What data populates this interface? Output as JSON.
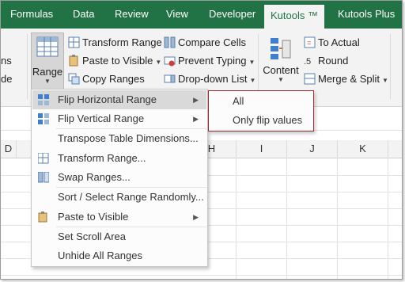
{
  "tabs": [
    {
      "label": "Formulas",
      "active": false
    },
    {
      "label": "Data",
      "active": false
    },
    {
      "label": "Review",
      "active": false
    },
    {
      "label": "View",
      "active": false
    },
    {
      "label": "Developer",
      "active": false
    },
    {
      "label": "Kutools ™",
      "active": true
    },
    {
      "label": "Kutools Plus",
      "active": false
    }
  ],
  "ribbon": {
    "left_partial_1": "ns",
    "left_partial_2": "de",
    "range_label": "Range",
    "transform_range": "Transform Range",
    "paste_to_visible": "Paste to Visible",
    "copy_ranges": "Copy Ranges",
    "compare_cells": "Compare Cells",
    "prevent_typing": "Prevent Typing",
    "dropdown_list": "Drop-down List",
    "content": "Content",
    "to_actual": "To Actual",
    "round": "Round",
    "merge_split": "Merge & Split"
  },
  "columns": [
    "D",
    "H",
    "I",
    "J",
    "K"
  ],
  "menu": {
    "items": [
      {
        "label": "Flip Horizontal Range",
        "has_sub": true
      },
      {
        "label": "Flip Vertical Range",
        "has_sub": true
      },
      {
        "label": "Transpose Table Dimensions...",
        "has_sub": false
      },
      {
        "label": "Transform Range...",
        "has_sub": false
      },
      {
        "label": "Swap Ranges...",
        "has_sub": false
      },
      {
        "label": "Sort / Select Range Randomly...",
        "has_sub": false
      },
      {
        "label": "Paste to Visible",
        "has_sub": true
      },
      {
        "label": "Set Scroll Area",
        "has_sub": false
      },
      {
        "label": "Unhide All Ranges",
        "has_sub": false
      }
    ]
  },
  "submenu": {
    "items": [
      "All",
      "Only flip values"
    ]
  },
  "colors": {
    "accent": "#217346",
    "highlight": "#d9d9d9",
    "submenu_border": "#a02a2a"
  }
}
